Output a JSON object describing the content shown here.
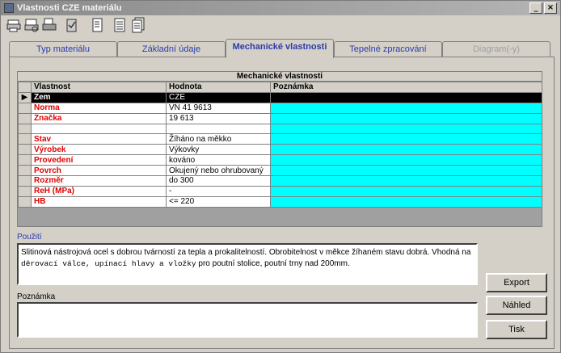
{
  "window": {
    "title": "Vlastnosti CZE materiálu"
  },
  "titlebar_buttons": [
    "_",
    "□",
    "×"
  ],
  "toolbar": {
    "tools": [
      "printer-icon",
      "print-preview-icon",
      "copy-icon",
      "clipboard-check-icon",
      "document-icon",
      "document-list-icon",
      "document-stack-icon"
    ]
  },
  "tabs": [
    {
      "label": "Typ materiálu",
      "state": "normal"
    },
    {
      "label": "Základní údaje",
      "state": "normal"
    },
    {
      "label": "Mechanické vlastnosti",
      "state": "active"
    },
    {
      "label": "Tepelné zpracování",
      "state": "normal"
    },
    {
      "label": "Diagram(-y)",
      "state": "disabled"
    }
  ],
  "grid": {
    "caption": "Mechanické vlastnosti",
    "columns": [
      "Vlastnost",
      "Hodnota",
      "Poznámka"
    ],
    "rows": [
      {
        "property": "Zem",
        "value": "CZE",
        "note": "",
        "selected": true
      },
      {
        "property": "Norma",
        "value": "VN 41 9613",
        "note": ""
      },
      {
        "property": "Značka",
        "value": "19 613",
        "note": ""
      },
      {
        "property": "",
        "value": "",
        "note": ""
      },
      {
        "property": "Stav",
        "value": "Žíháno na měkko",
        "note": ""
      },
      {
        "property": "Výrobek",
        "value": "Výkovky",
        "note": ""
      },
      {
        "property": "Provedení",
        "value": "kováno",
        "note": ""
      },
      {
        "property": "Povrch",
        "value": "Okujený nebo ohrubovaný",
        "note": ""
      },
      {
        "property": "Rozměr",
        "value": "do 300",
        "note": ""
      },
      {
        "property": "ReH (MPa)",
        "value": "-",
        "note": ""
      },
      {
        "property": "HB",
        "value": "<= 220",
        "note": ""
      }
    ],
    "selected_indicator": "▶"
  },
  "usage": {
    "label": "Použití",
    "line1": "Slitinová nástrojová ocel s dobrou  tvárností za tepla a prokalitelností. Obrobitelnost v měkce  žíhaném stavu dobrá. Vhodná na",
    "line2a": "děrovací válce, upínací hlavy a vložky",
    "line2b": " pro poutní stolice, poutní trny nad 200mm."
  },
  "note": {
    "label": "Poznámka",
    "value": ""
  },
  "buttons": {
    "export": "Export",
    "preview": "Náhled",
    "print": "Tisk"
  },
  "colors": {
    "note_cell": "#00ffff",
    "property_text": "#e00000",
    "tab_text": "#2a3caa"
  }
}
